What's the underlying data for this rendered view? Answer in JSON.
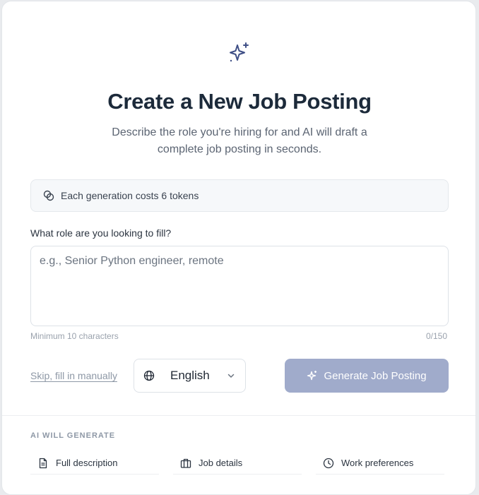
{
  "header": {
    "title": "Create a New Job Posting",
    "subtitle": "Describe the role you're hiring for and AI will draft a complete job posting in seconds."
  },
  "token_notice": {
    "icon": "coins-icon",
    "text": "Each generation costs 6 tokens"
  },
  "role_field": {
    "label": "What role are you looking to fill?",
    "placeholder": "e.g., Senior Python engineer, remote",
    "value": "",
    "hint": "Minimum 10 characters",
    "counter": "0/150"
  },
  "actions": {
    "skip_label": "Skip, fill in manually",
    "language": {
      "icon": "globe-icon",
      "value": "English"
    },
    "generate_label": "Generate Job Posting"
  },
  "ai_section": {
    "heading": "AI WILL GENERATE",
    "items": [
      {
        "icon": "document-icon",
        "label": "Full description"
      },
      {
        "icon": "briefcase-icon",
        "label": "Job details"
      },
      {
        "icon": "clock-icon",
        "label": "Work preferences"
      }
    ]
  },
  "colors": {
    "accent": "#3f4f86",
    "button_disabled": "#a0abcb",
    "title": "#1c2a3a"
  }
}
